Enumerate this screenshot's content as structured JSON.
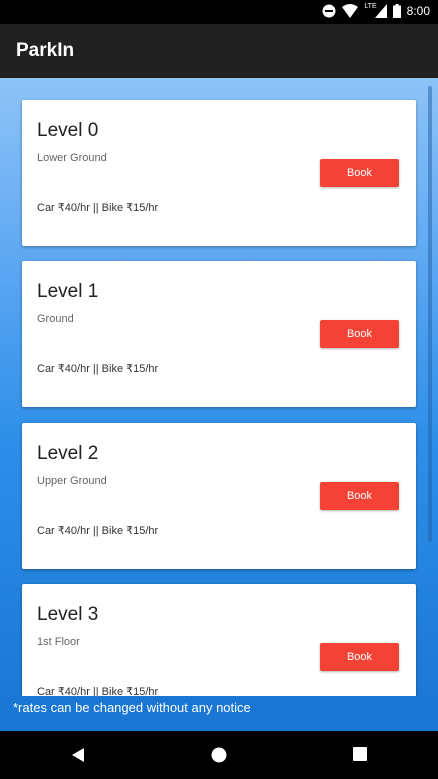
{
  "status": {
    "time": "8:00",
    "network": "LTE"
  },
  "app": {
    "title": "ParkIn"
  },
  "levels": [
    {
      "title": "Level 0",
      "subtitle": "Lower Ground",
      "rates": "Car ₹40/hr || Bike ₹15/hr",
      "button": "Book"
    },
    {
      "title": "Level 1",
      "subtitle": "Ground",
      "rates": "Car ₹40/hr || Bike ₹15/hr",
      "button": "Book"
    },
    {
      "title": "Level 2",
      "subtitle": "Upper Ground",
      "rates": "Car ₹40/hr || Bike ₹15/hr",
      "button": "Book"
    },
    {
      "title": "Level 3",
      "subtitle": "1st Floor",
      "rates": "Car ₹40/hr || Bike ₹15/hr",
      "button": "Book"
    }
  ],
  "notice": "*rates can be changed without any notice",
  "icons": {
    "status": [
      "do-not-disturb-icon",
      "wifi-icon",
      "signal-icon",
      "battery-icon"
    ],
    "nav": [
      "back-icon",
      "home-icon",
      "recents-icon"
    ]
  },
  "colors": {
    "accent": "#f44336",
    "appbar": "#212121",
    "background": "#1976d2"
  }
}
